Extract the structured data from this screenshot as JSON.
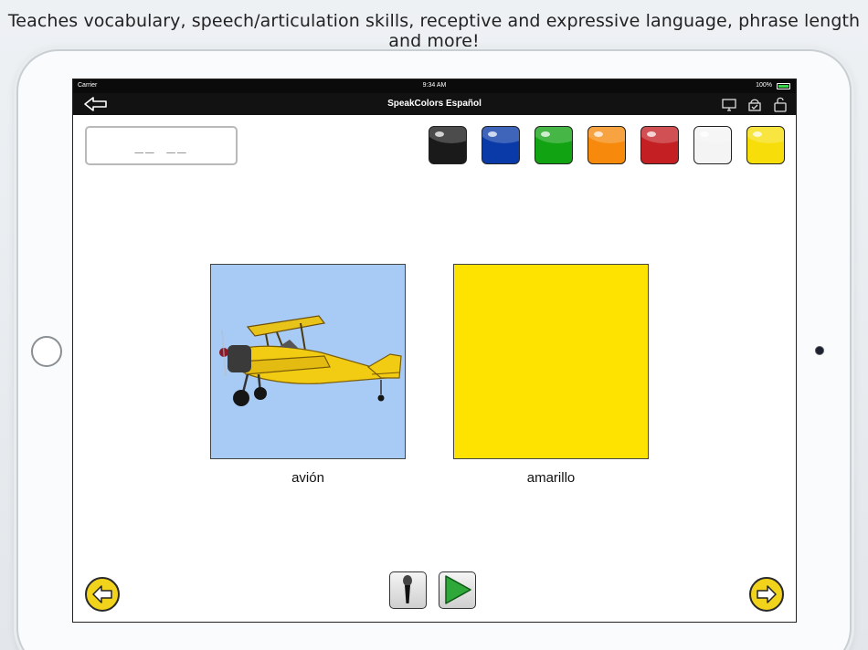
{
  "headline": "Teaches vocabulary, speech/articulation skills, receptive and expressive language, phrase length and more!",
  "status_bar": {
    "carrier": "Carrier",
    "time": "9:34 AM",
    "battery": "100%"
  },
  "nav": {
    "title": "SpeakColors Español",
    "icons": [
      "back-arrow-icon",
      "monitor-icon",
      "basket-icon",
      "unlock-icon"
    ]
  },
  "answer_box": {
    "value": "__ __"
  },
  "color_swatches": [
    {
      "name": "black",
      "hex": "#1a1a1a"
    },
    {
      "name": "blue",
      "hex": "#0a3aa8"
    },
    {
      "name": "green",
      "hex": "#12a312"
    },
    {
      "name": "orange",
      "hex": "#f78a0c"
    },
    {
      "name": "red",
      "hex": "#c41f23"
    },
    {
      "name": "white",
      "hex": "#f4f4f4"
    },
    {
      "name": "yellow",
      "hex": "#f7de0a"
    }
  ],
  "cards": {
    "left": {
      "label": "avión",
      "bg": "#a8cbf5"
    },
    "right": {
      "label": "amarillo",
      "color": "#ffe300"
    }
  },
  "controls": [
    "prev-arrow-icon",
    "microphone-icon",
    "play-icon",
    "next-arrow-icon"
  ]
}
